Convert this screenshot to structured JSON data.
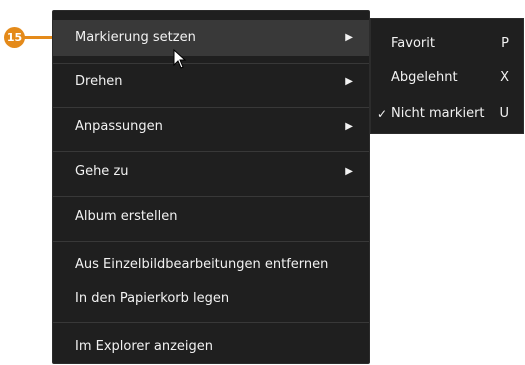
{
  "callout": {
    "number": "15"
  },
  "context_menu": {
    "items": [
      {
        "label": "Markierung setzen",
        "arrow": "▶"
      },
      {
        "label": "Drehen",
        "arrow": "▶"
      },
      {
        "label": "Anpassungen",
        "arrow": "▶"
      },
      {
        "label": "Gehe zu",
        "arrow": "▶"
      },
      {
        "label": "Album erstellen"
      },
      {
        "label": "Aus Einzelbildbearbeitungen entfernen"
      },
      {
        "label": "In den Papierkorb legen"
      },
      {
        "label": "Im Explorer anzeigen"
      }
    ]
  },
  "submenu": {
    "items": [
      {
        "label": "Favorit",
        "shortcut": "P",
        "checked": false
      },
      {
        "label": "Abgelehnt",
        "shortcut": "X",
        "checked": false
      },
      {
        "label": "Nicht markiert",
        "shortcut": "U",
        "checked": true,
        "check": "✓"
      }
    ]
  },
  "colors": {
    "menu_bg": "#1f1f1f",
    "highlight": "#393939",
    "callout": "#e48a1a"
  }
}
